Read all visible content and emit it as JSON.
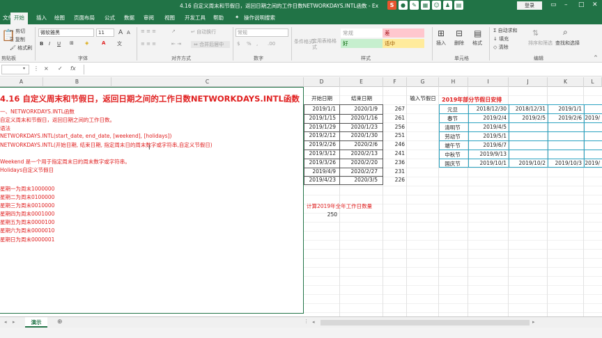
{
  "window": {
    "title": "4.16 自定义周末和节假日，返回日期之间的工作日数NETWORKDAYS.INTL函数 - Ex",
    "login": "登录",
    "brand_icon": "S",
    "colors": {
      "brand": "#217346",
      "red_text": "#e02020",
      "accent_blue": "#2aa2c0"
    }
  },
  "tabs": [
    "文件",
    "开始",
    "插入",
    "绘图",
    "页面布局",
    "公式",
    "数据",
    "审阅",
    "视图",
    "开发工具",
    "帮助",
    "操作说明搜索"
  ],
  "active_tab": "开始",
  "ribbon": {
    "clipboard": {
      "cut": "剪切",
      "copy": "复制",
      "painter": "格式刷",
      "label": "剪贴板"
    },
    "font": {
      "name": "微软雅黑",
      "size": "11",
      "label": "字体",
      "bold": "B",
      "italic": "I",
      "underline": "U",
      "grow": "A",
      "shrink": "A"
    },
    "alignment": {
      "wrap": "自动换行",
      "merge": "合并后居中",
      "label": "对齐方式"
    },
    "number": {
      "format": "常规",
      "label": "数字",
      "percent": "%",
      "comma": ",",
      "inc": ".00"
    },
    "styles": {
      "conditional": "条件格式",
      "table": "套用表格格式",
      "normal": "常规",
      "bad": "差",
      "good": "好",
      "neutral": "适中",
      "label": "样式"
    },
    "cells": {
      "insert": "插入",
      "delete": "删除",
      "format": "格式",
      "label": "单元格"
    },
    "editing": {
      "autosum": "自动求和",
      "fill": "填充",
      "clear": "清除",
      "sort": "排序和筛选",
      "find": "查找和选择",
      "label": "编辑"
    }
  },
  "formula_bar": {
    "name_box": "",
    "cancel": "×",
    "enter": "✓",
    "fx": "fx"
  },
  "columns": [
    "A",
    "B",
    "C",
    "D",
    "E",
    "F",
    "G",
    "H",
    "I",
    "J",
    "K",
    "L"
  ],
  "text_block": {
    "heading": "4.16 自定义周末和节假日，返回日期之间的工作日数NETWORKDAYS.INTL函数",
    "lines": [
      "一、NETWORKDAYS.INTL函数",
      "自定义周末和节假日，返回日期之间的工作日数。",
      "语法",
      "NETWORKDAYS.INTL(start_date, end_date, [weekend], [holidays])",
      "NETWORKDAYS.INTL(开始日期, 结束日期, 指定周末日的周末数字或字符串,自定义节假日)",
      "",
      "Weekend 是一个用于指定周末日的周末数字或字符串。",
      "Holidays自定义节假日",
      "",
      "星期一为周末1000000",
      "星期二为周末0100000",
      "星期三为周末0010000",
      "星期四为周末0001000",
      "星期五为周末0000100",
      "星期六为周末0000010",
      "星期日为周末0000001"
    ]
  },
  "dates_table": {
    "headers": [
      "开始日期",
      "结束日期",
      ""
    ],
    "rows": [
      [
        "2019/1/1",
        "2020/1/9",
        "267"
      ],
      [
        "2019/1/15",
        "2020/1/16",
        "261"
      ],
      [
        "2019/1/29",
        "2020/1/23",
        "256"
      ],
      [
        "2019/2/12",
        "2020/1/30",
        "251"
      ],
      [
        "2019/2/26",
        "2020/2/6",
        "246"
      ],
      [
        "2019/3/12",
        "2020/2/13",
        "241"
      ],
      [
        "2019/3/26",
        "2020/2/20",
        "236"
      ],
      [
        "2019/4/9",
        "2020/2/27",
        "231"
      ],
      [
        "2019/4/23",
        "2020/3/5",
        "226"
      ]
    ],
    "input_label": "输入节假日"
  },
  "annual": {
    "label": "计算2019年全年工作日数量",
    "value": "250"
  },
  "holidays": {
    "title": "2019年部分节假日安排",
    "rows": [
      [
        "元旦",
        "2018/12/30",
        "2018/12/31",
        "2019/1/1",
        ""
      ],
      [
        "春节",
        "2019/2/4",
        "2019/2/5",
        "2019/2/6",
        "2019/"
      ],
      [
        "清明节",
        "2019/4/5",
        "",
        "",
        ""
      ],
      [
        "劳动节",
        "2019/5/1",
        "",
        "",
        ""
      ],
      [
        "端午节",
        "2019/6/7",
        "",
        "",
        ""
      ],
      [
        "中秋节",
        "2019/9/13",
        "",
        "",
        ""
      ],
      [
        "国庆节",
        "2019/10/1",
        "2019/10/2",
        "2019/10/3",
        "2019/"
      ]
    ]
  },
  "sheet_tabs": [
    "演示"
  ],
  "add_sheet": "⊕"
}
